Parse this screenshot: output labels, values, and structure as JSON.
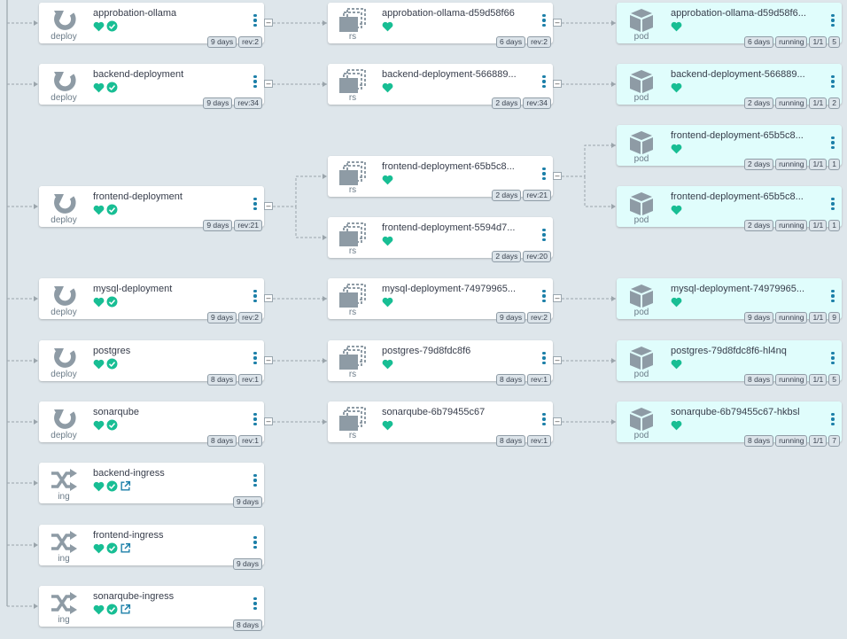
{
  "colors": {
    "healthy": "#18be94",
    "link": "#1b7fa8",
    "icon": "#8e9ba5",
    "edge": "#9aa4ab"
  },
  "nodes": {
    "d_ollama": {
      "kind": "deploy",
      "title": "approbation-ollama",
      "age": "9 days",
      "rev": "rev:2"
    },
    "d_backend": {
      "kind": "deploy",
      "title": "backend-deployment",
      "age": "9 days",
      "rev": "rev:34"
    },
    "d_frontend": {
      "kind": "deploy",
      "title": "frontend-deployment",
      "age": "9 days",
      "rev": "rev:21"
    },
    "d_mysql": {
      "kind": "deploy",
      "title": "mysql-deployment",
      "age": "9 days",
      "rev": "rev:2"
    },
    "d_postgres": {
      "kind": "deploy",
      "title": "postgres",
      "age": "8 days",
      "rev": "rev:1"
    },
    "d_sonar": {
      "kind": "deploy",
      "title": "sonarqube",
      "age": "8 days",
      "rev": "rev:1"
    },
    "i_backend": {
      "kind": "ing",
      "title": "backend-ingress",
      "age": "9 days"
    },
    "i_frontend": {
      "kind": "ing",
      "title": "frontend-ingress",
      "age": "9 days"
    },
    "i_sonar": {
      "kind": "ing",
      "title": "sonarqube-ingress",
      "age": "8 days"
    },
    "r_ollama": {
      "kind": "rs",
      "title": "approbation-ollama-d59d58f66",
      "age": "6 days",
      "rev": "rev:2"
    },
    "r_backend": {
      "kind": "rs",
      "title": "backend-deployment-566889...",
      "age": "2 days",
      "rev": "rev:34"
    },
    "r_front1": {
      "kind": "rs",
      "title": "frontend-deployment-65b5c8...",
      "age": "2 days",
      "rev": "rev:21"
    },
    "r_front2": {
      "kind": "rs",
      "title": "frontend-deployment-5594d7...",
      "age": "2 days",
      "rev": "rev:20"
    },
    "r_mysql": {
      "kind": "rs",
      "title": "mysql-deployment-74979965...",
      "age": "9 days",
      "rev": "rev:2"
    },
    "r_postgres": {
      "kind": "rs",
      "title": "postgres-79d8fdc8f6",
      "age": "8 days",
      "rev": "rev:1"
    },
    "r_sonar": {
      "kind": "rs",
      "title": "sonarqube-6b79455c67",
      "age": "8 days",
      "rev": "rev:1"
    },
    "p_ollama": {
      "kind": "pod",
      "title": "approbation-ollama-d59d58f6...",
      "age": "6 days",
      "state": "running",
      "ready": "1/1",
      "restarts": "5"
    },
    "p_backend": {
      "kind": "pod",
      "title": "backend-deployment-566889...",
      "age": "2 days",
      "state": "running",
      "ready": "1/1",
      "restarts": "2"
    },
    "p_front1": {
      "kind": "pod",
      "title": "frontend-deployment-65b5c8...",
      "age": "2 days",
      "state": "running",
      "ready": "1/1",
      "restarts": "1"
    },
    "p_front2": {
      "kind": "pod",
      "title": "frontend-deployment-65b5c8...",
      "age": "2 days",
      "state": "running",
      "ready": "1/1",
      "restarts": "1"
    },
    "p_mysql": {
      "kind": "pod",
      "title": "mysql-deployment-74979965...",
      "age": "9 days",
      "state": "running",
      "ready": "1/1",
      "restarts": "9"
    },
    "p_postgres": {
      "kind": "pod",
      "title": "postgres-79d8fdc8f6-hl4nq",
      "age": "8 days",
      "state": "running",
      "ready": "1/1",
      "restarts": "5"
    },
    "p_sonar": {
      "kind": "pod",
      "title": "sonarqube-6b79455c67-hkbsl",
      "age": "8 days",
      "state": "running",
      "ready": "1/1",
      "restarts": "7"
    }
  },
  "collapse_symbol": "–"
}
